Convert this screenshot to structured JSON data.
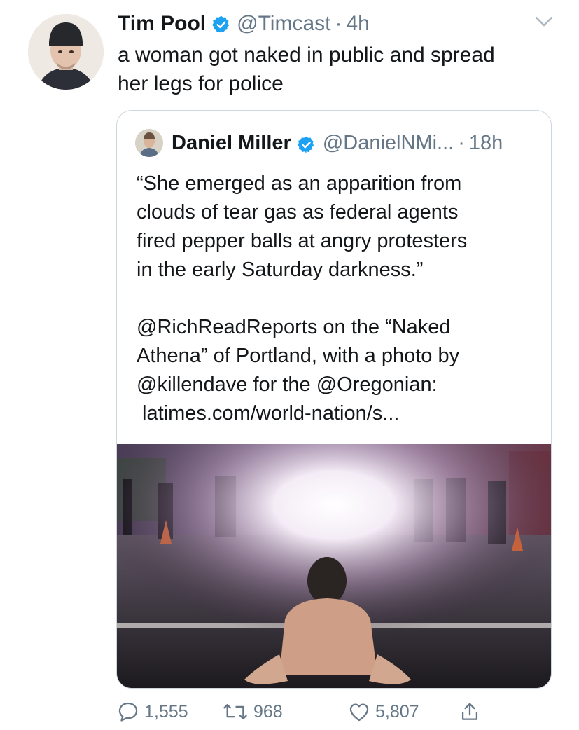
{
  "tweet": {
    "author_name": "Tim Pool",
    "handle": "@Timcast",
    "separator": "·",
    "time": "4h",
    "text_lines": [
      "a woman got naked in public and spread",
      "her legs for police"
    ]
  },
  "quote": {
    "author_name": "Daniel Miller",
    "handle": "@DanielNMi...",
    "separator": "·",
    "time": "18h",
    "text_lines": [
      "“She emerged as an apparition from",
      "clouds of tear gas as federal agents",
      "fired pepper balls at angry protesters",
      "in the early Saturday darkness.”"
    ],
    "text_lines_2": [
      "@RichReadReports on the “Naked",
      "Athena” of Portland, with a photo by",
      "@killendave for the @Oregonian:"
    ],
    "link": "latimes.com/world-nation/s..."
  },
  "actions": {
    "replies": "1,555",
    "retweets": "968",
    "likes": "5,807"
  },
  "icons": [
    "verified-badge-icon",
    "chevron-down-icon",
    "reply-icon",
    "retweet-icon",
    "like-icon",
    "share-icon"
  ],
  "colors": {
    "text": "#14171a",
    "muted": "#657786",
    "verified": "#1da1f2",
    "border": "#ccd6dd"
  }
}
